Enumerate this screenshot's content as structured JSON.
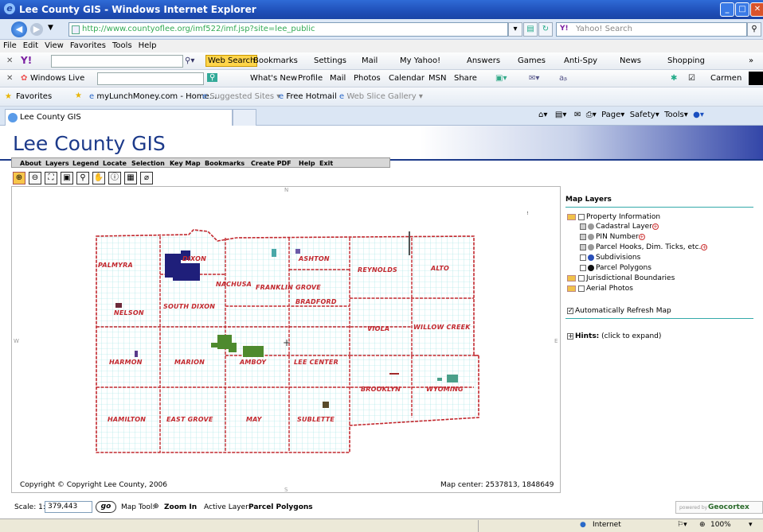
{
  "window": {
    "title": "Lee County GIS - Windows Internet Explorer"
  },
  "address": {
    "url": "http://www.countyoflee.org/imf522/imf.jsp?site=lee_public",
    "search_placeholder": "Yahoo! Search"
  },
  "menu": [
    "File",
    "Edit",
    "View",
    "Favorites",
    "Tools",
    "Help"
  ],
  "yahoo_toolbar": [
    "Web Search",
    "Bookmarks",
    "Settings",
    "Mail",
    "My Yahoo!",
    "Answers",
    "Games",
    "Anti-Spy",
    "News",
    "Shopping"
  ],
  "live_toolbar": {
    "brand": "Windows Live",
    "links": [
      "What's New",
      "Profile",
      "Mail",
      "Photos",
      "Calendar",
      "MSN",
      "Share"
    ],
    "user": "Carmen"
  },
  "favorites_bar": {
    "favorites_label": "Favorites",
    "items": [
      "myLunchMoney.com - Home...",
      "Suggested Sites",
      "Free Hotmail",
      "Web Slice Gallery"
    ]
  },
  "tab": {
    "title": "Lee County GIS"
  },
  "command_bar": [
    "Page",
    "Safety",
    "Tools"
  ],
  "app": {
    "title": "Lee County GIS",
    "menu": [
      "About",
      "Layers",
      "Legend",
      "Locate",
      "Selection",
      "Key Map",
      "Bookmarks",
      "Create PDF",
      "Help",
      "Exit"
    ],
    "tool_icons": [
      "zoom-in-icon",
      "zoom-out-icon",
      "full-extent-icon",
      "zoom-active-icon",
      "zoom-previous-icon",
      "pan-icon",
      "identify-icon",
      "query-icon",
      "clear-icon"
    ]
  },
  "map": {
    "compass": {
      "n": "N",
      "s": "S",
      "w": "W",
      "e": "E"
    },
    "townships": [
      "PALMYRA",
      "DIXON",
      "ASHTON",
      "REYNOLDS",
      "ALTO",
      "NACHUSA",
      "FRANKLIN GROVE",
      "BRADFORD",
      "SOUTH DIXON",
      "NELSON",
      "VIOLA",
      "WILLOW CREEK",
      "HARMON",
      "MARION",
      "AMBOY",
      "LEE CENTER",
      "BROOKLYN",
      "WYOMING",
      "HAMILTON",
      "EAST GROVE",
      "MAY",
      "SUBLETTE"
    ],
    "copyright": "Copyright © Copyright Lee County, 2006",
    "center": "Map center: 2537813, 1848649"
  },
  "layers": {
    "title": "Map Layers",
    "groups": [
      {
        "label": "Property Information"
      },
      {
        "label": "Cadastral Layer"
      },
      {
        "label": "PIN Number"
      },
      {
        "label": "Parcel Hooks, Dim. Ticks, etc."
      },
      {
        "label": "Subdivisions"
      },
      {
        "label": "Parcel Polygons"
      },
      {
        "label": "Jurisdictional Boundaries"
      },
      {
        "label": "Aerial Photos"
      }
    ],
    "auto_refresh": "Automatically Refresh Map",
    "hints_label": "Hints:",
    "hints_text": "(click to expand)"
  },
  "scale": {
    "label": "Scale: 1:",
    "value": "379,443",
    "go": "go",
    "tool_label": "Map Tool:",
    "tool_value": "Zoom In",
    "active_label": "Active Layer:",
    "active_value": "Parcel Polygons",
    "powered": "powered by",
    "brand": "Geocortex"
  },
  "status": {
    "zone": "Internet",
    "zoom": "100%"
  }
}
